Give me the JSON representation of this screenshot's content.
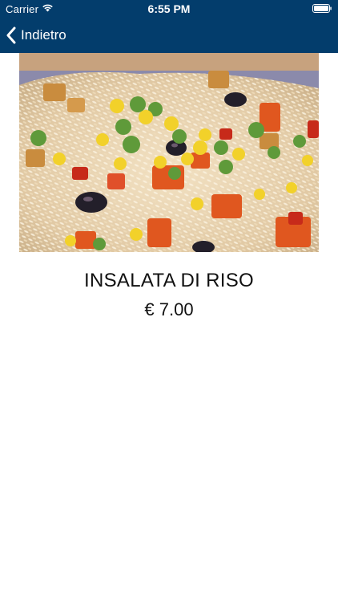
{
  "status_bar": {
    "carrier": "Carrier",
    "time": "6:55 PM",
    "wifi_icon": "wifi-icon",
    "battery_icon": "battery-icon"
  },
  "nav_bar": {
    "back_label": "Indietro",
    "back_icon": "chevron-left-icon",
    "background_color": "#033d6c"
  },
  "product": {
    "image": "rice-salad-photo",
    "name": "INSALATA DI RISO",
    "price": "€ 7.00"
  }
}
